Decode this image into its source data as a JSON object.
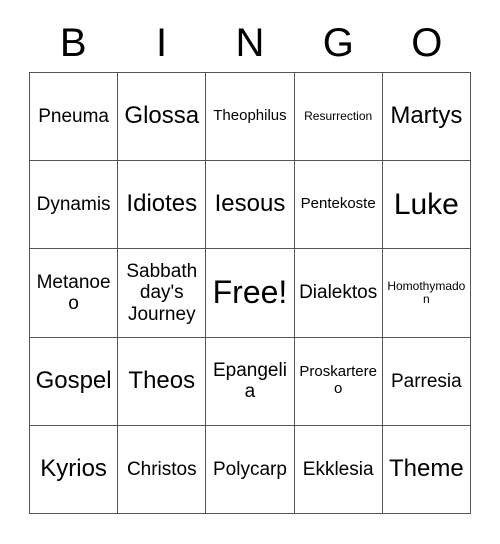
{
  "card": {
    "header_letters": [
      "B",
      "I",
      "N",
      "G",
      "O"
    ],
    "grid": {
      "columns": 5,
      "rows": 5,
      "border_color": "#555555",
      "background_color": "#ffffff",
      "text_color": "#000000"
    },
    "rows": [
      [
        {
          "text": "Pneuma",
          "size": "md"
        },
        {
          "text": "Glossa",
          "size": "lg"
        },
        {
          "text": "Theophilus",
          "size": "sm"
        },
        {
          "text": "Resurrection",
          "size": "xs"
        },
        {
          "text": "Martys",
          "size": "lg"
        }
      ],
      [
        {
          "text": "Dynamis",
          "size": "md"
        },
        {
          "text": "Idiotes",
          "size": "lg"
        },
        {
          "text": "Iesous",
          "size": "lg"
        },
        {
          "text": "Pentekoste",
          "size": "sm"
        },
        {
          "text": "Luke",
          "size": "xl"
        }
      ],
      [
        {
          "text": "Metanoeo",
          "size": "md"
        },
        {
          "text": "Sabbath day's Journey",
          "size": "md"
        },
        {
          "text": "Free!",
          "size": "free"
        },
        {
          "text": "Dialektos",
          "size": "md"
        },
        {
          "text": "Homothymadon",
          "size": "xs"
        }
      ],
      [
        {
          "text": "Gospel",
          "size": "lg"
        },
        {
          "text": "Theos",
          "size": "lg"
        },
        {
          "text": "Epangelia",
          "size": "md"
        },
        {
          "text": "Proskartereo",
          "size": "sm"
        },
        {
          "text": "Parresia",
          "size": "md"
        }
      ],
      [
        {
          "text": "Kyrios",
          "size": "lg"
        },
        {
          "text": "Christos",
          "size": "md"
        },
        {
          "text": "Polycarp",
          "size": "md"
        },
        {
          "text": "Ekklesia",
          "size": "md"
        },
        {
          "text": "Theme",
          "size": "lg"
        }
      ]
    ]
  }
}
